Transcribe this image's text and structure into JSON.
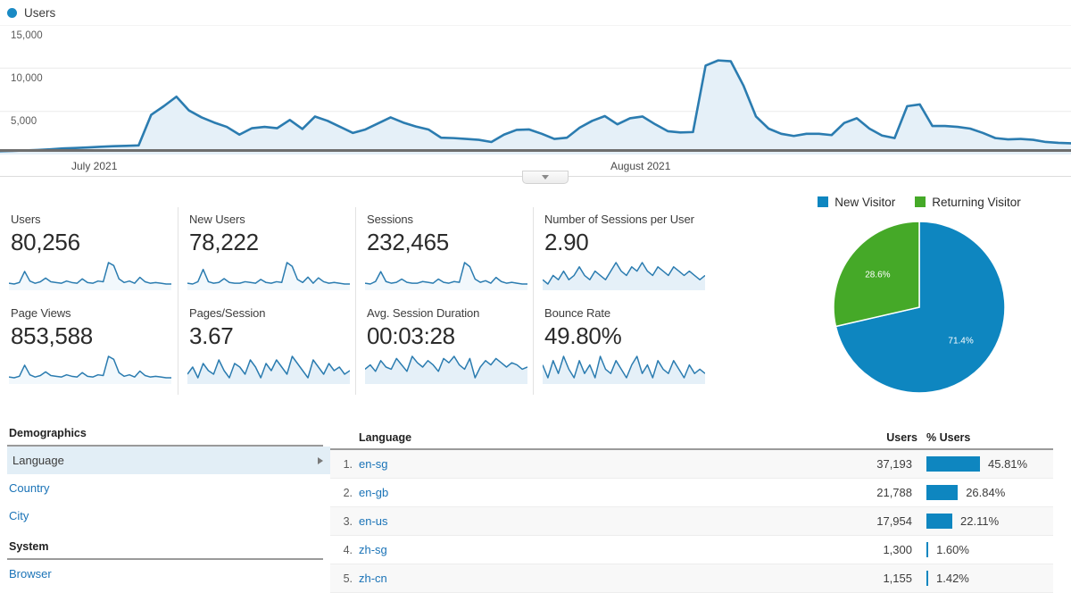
{
  "chart_panel": {
    "legend_label": "Users",
    "legend_color": "#1a8ac4",
    "handle_icon": "chevron-down-icon"
  },
  "metrics": [
    {
      "title": "Users",
      "value": "80,256",
      "filled": false
    },
    {
      "title": "New Users",
      "value": "78,222",
      "filled": false
    },
    {
      "title": "Sessions",
      "value": "232,465",
      "filled": false
    },
    {
      "title": "Number of Sessions per User",
      "value": "2.90",
      "filled": true
    },
    {
      "title": "Page Views",
      "value": "853,588",
      "filled": false
    },
    {
      "title": "Pages/Session",
      "value": "3.67",
      "filled": true
    },
    {
      "title": "Avg. Session Duration",
      "value": "00:03:28",
      "filled": true
    },
    {
      "title": "Bounce Rate",
      "value": "49.80%",
      "filled": true
    }
  ],
  "sidebar": {
    "groups": [
      {
        "title": "Demographics",
        "items": [
          {
            "label": "Language",
            "selected": true
          },
          {
            "label": "Country",
            "selected": false
          },
          {
            "label": "City",
            "selected": false
          }
        ]
      },
      {
        "title": "System",
        "items": [
          {
            "label": "Browser",
            "selected": false
          }
        ]
      }
    ]
  },
  "table": {
    "headers": {
      "label": "Language",
      "users": "Users",
      "pct": "% Users"
    },
    "rows": [
      {
        "rank": "1.",
        "label": "en-sg",
        "users": "37,193",
        "pct": "45.81%",
        "pct_value": 45.81
      },
      {
        "rank": "2.",
        "label": "en-gb",
        "users": "21,788",
        "pct": "26.84%",
        "pct_value": 26.84
      },
      {
        "rank": "3.",
        "label": "en-us",
        "users": "17,954",
        "pct": "22.11%",
        "pct_value": 22.11
      },
      {
        "rank": "4.",
        "label": "zh-sg",
        "users": "1,300",
        "pct": "1.60%",
        "pct_value": 1.6
      },
      {
        "rank": "5.",
        "label": "zh-cn",
        "users": "1,155",
        "pct": "1.42%",
        "pct_value": 1.42
      }
    ]
  },
  "colors": {
    "accent_blue": "#0e86c0",
    "line_blue": "#2b7cb0",
    "area_blue": "#e5f0f8",
    "pie_green": "#45a928",
    "link_blue": "#1a73b7"
  },
  "chart_data": [
    {
      "type": "area",
      "title": "Users",
      "xlabel": "",
      "ylabel": "Users",
      "ylim": [
        0,
        15000
      ],
      "yticks": [
        5000,
        10000,
        15000
      ],
      "ytick_labels": [
        "5,000",
        "10,000",
        "15,000"
      ],
      "xticks": [
        "July 2021",
        "August 2021"
      ],
      "grid": true,
      "legend": [
        "Users"
      ],
      "legend_position": "top-left",
      "series": [
        {
          "name": "Users",
          "values": [
            380,
            420,
            470,
            520,
            600,
            700,
            760,
            820,
            900,
            960,
            1000,
            1050,
            4600,
            5600,
            6700,
            5100,
            4300,
            3700,
            3200,
            2300,
            3050,
            3200,
            3050,
            4000,
            2950,
            4400,
            3900,
            3200,
            2500,
            2900,
            3600,
            4300,
            3700,
            3250,
            2900,
            1950,
            1900,
            1800,
            1700,
            1450,
            2300,
            2850,
            2900,
            2400,
            1800,
            1950,
            3100,
            3900,
            4450,
            3500,
            4200,
            4400,
            3500,
            2700,
            2550,
            2600,
            10300,
            10900,
            10800,
            8000,
            4400,
            3000,
            2400,
            2150,
            2400,
            2400,
            2250,
            3650,
            4200,
            3000,
            2200,
            1900,
            5600,
            5800,
            3300,
            3300,
            3200,
            3000,
            2500,
            1900,
            1750,
            1800,
            1700,
            1450,
            1350,
            1300
          ]
        }
      ]
    },
    {
      "type": "pie",
      "title": "New vs Returning Visitor",
      "labels": [
        "New Visitor",
        "Returning Visitor"
      ],
      "values": [
        71.4,
        28.6
      ],
      "value_labels": [
        "71.4%",
        "28.6%"
      ],
      "colors": [
        "#0e86c0",
        "#45a928"
      ],
      "legend_position": "top"
    },
    {
      "type": "bar",
      "title": "Language",
      "categories": [
        "en-sg",
        "en-gb",
        "en-us",
        "zh-sg",
        "zh-cn"
      ],
      "values": [
        45.81,
        26.84,
        22.11,
        1.6,
        1.42
      ],
      "ylabel": "% Users",
      "xlabel": "Language"
    }
  ]
}
